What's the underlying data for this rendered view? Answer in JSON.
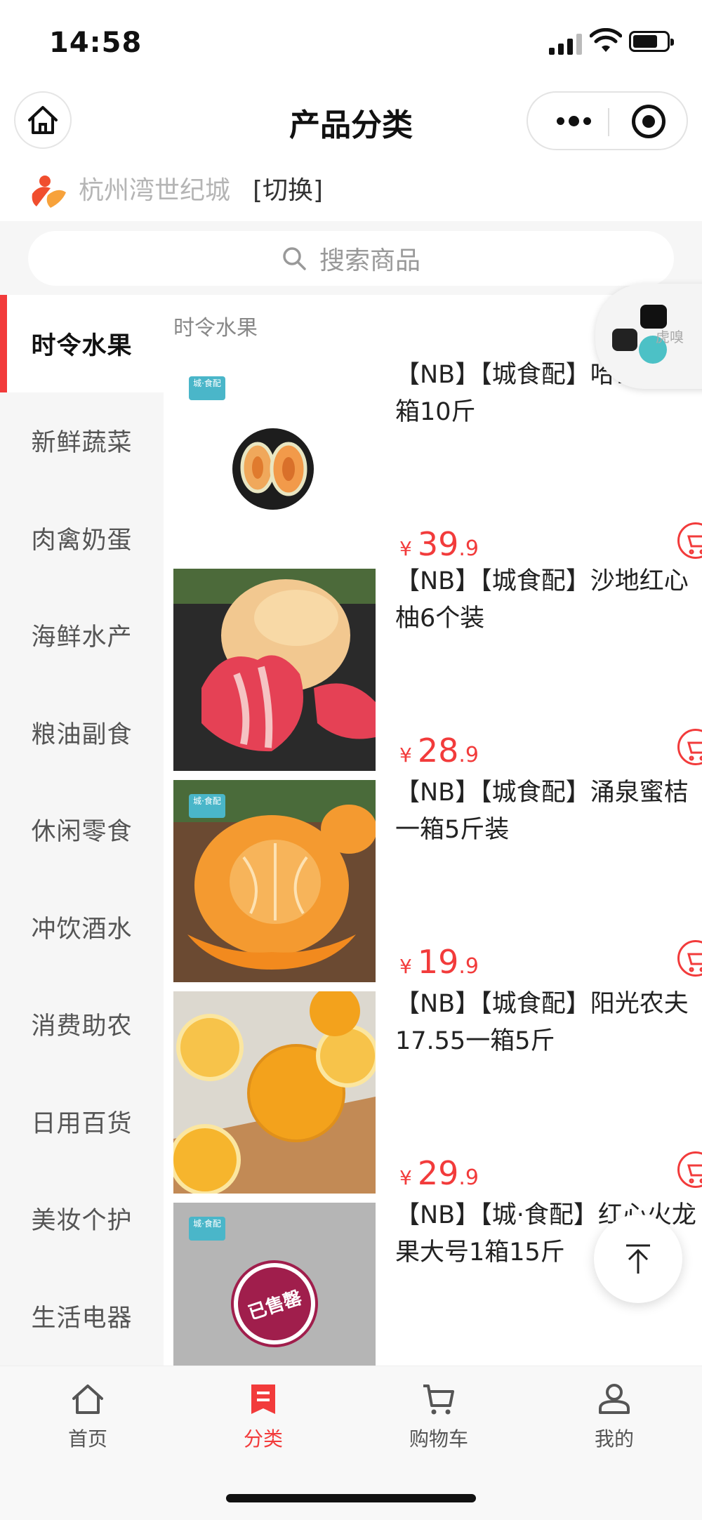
{
  "status_bar": {
    "time": "14:58"
  },
  "header": {
    "title": "产品分类"
  },
  "location": {
    "name": "杭州湾世纪城",
    "switch_label": "[切换]"
  },
  "search": {
    "placeholder": "搜索商品"
  },
  "sidebar": {
    "items": [
      {
        "label": "时令水果",
        "active": true
      },
      {
        "label": "新鲜蔬菜"
      },
      {
        "label": "肉禽奶蛋"
      },
      {
        "label": "海鲜水产"
      },
      {
        "label": "粮油副食"
      },
      {
        "label": "休闲零食"
      },
      {
        "label": "冲饮酒水"
      },
      {
        "label": "消费助农"
      },
      {
        "label": "日用百货"
      },
      {
        "label": "美妆个护"
      },
      {
        "label": "生活电器"
      }
    ]
  },
  "section": {
    "title": "时令水果"
  },
  "products": [
    {
      "title": "【NB】【城食配】哈密瓜一箱10斤",
      "price_symbol": "¥",
      "price_int": "39",
      "price_dec": ".9",
      "image_tag": "城·食配"
    },
    {
      "title": "【NB】【城食配】沙地红心柚6个装",
      "price_symbol": "¥",
      "price_int": "28",
      "price_dec": ".9"
    },
    {
      "title": "【NB】【城食配】涌泉蜜桔一箱5斤装",
      "price_symbol": "¥",
      "price_int": "19",
      "price_dec": ".9",
      "image_tag": "城·食配"
    },
    {
      "title": "【NB】【城食配】阳光农夫17.55一箱5斤",
      "price_symbol": "¥",
      "price_int": "29",
      "price_dec": ".9"
    },
    {
      "title": "【NB】【城·食配】红心火龙果大号1箱15斤",
      "image_tag": "城·食配",
      "sold_badge": "已售罄"
    }
  ],
  "float_widget": {
    "text": "虎嗅"
  },
  "tabbar": {
    "items": [
      {
        "label": "首页",
        "icon": "home-icon"
      },
      {
        "label": "分类",
        "icon": "category-icon",
        "active": true
      },
      {
        "label": "购物车",
        "icon": "cart-icon"
      },
      {
        "label": "我的",
        "icon": "profile-icon"
      }
    ]
  },
  "colors": {
    "accent": "#f23b3b",
    "sidebar_bg": "#f6f6f6",
    "price": "#f23b3b"
  }
}
